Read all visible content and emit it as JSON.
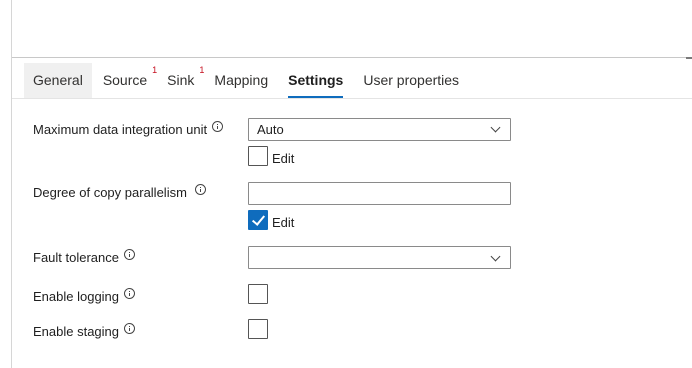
{
  "tabs": [
    {
      "label": "General",
      "badge": ""
    },
    {
      "label": "Source",
      "badge": "1"
    },
    {
      "label": "Sink",
      "badge": "1"
    },
    {
      "label": "Mapping",
      "badge": ""
    },
    {
      "label": "Settings",
      "badge": ""
    },
    {
      "label": "User properties",
      "badge": ""
    }
  ],
  "selected_tab": "Settings",
  "accent_color": "#0f6cbd",
  "badge_color": "#c50f1f",
  "settings": {
    "max_diu": {
      "label": "Maximum data integration unit",
      "value": "Auto",
      "edit_label": "Edit",
      "edit_checked": false
    },
    "parallelism": {
      "label": "Degree of copy parallelism",
      "value": "",
      "edit_label": "Edit",
      "edit_checked": true
    },
    "fault_tolerance": {
      "label": "Fault tolerance",
      "value": ""
    },
    "enable_logging": {
      "label": "Enable logging",
      "checked": false
    },
    "enable_staging": {
      "label": "Enable staging",
      "checked": false
    }
  }
}
